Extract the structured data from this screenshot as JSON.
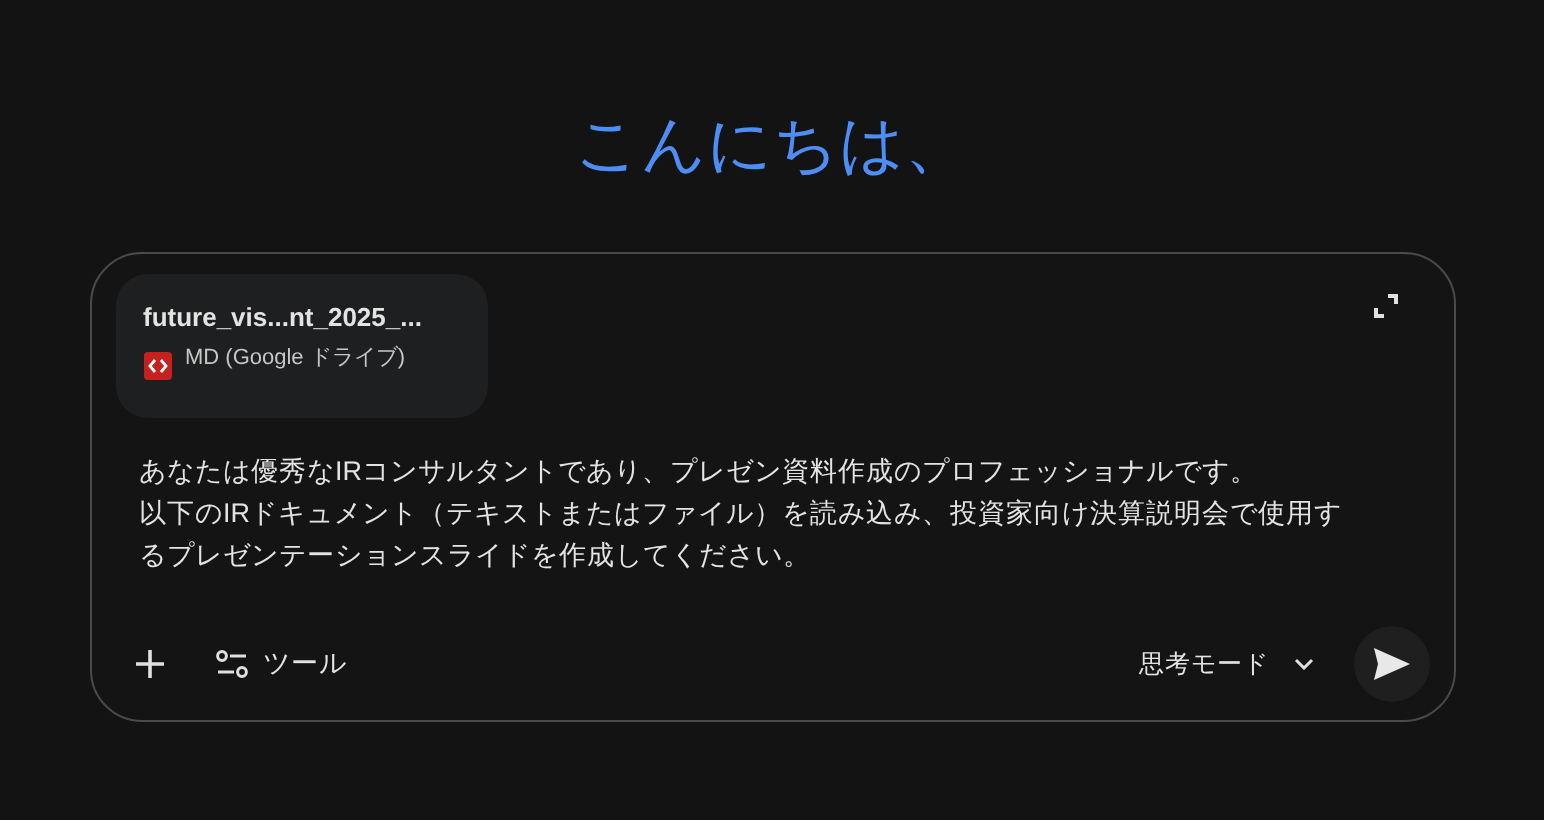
{
  "greeting": "こんにちは、",
  "attachment": {
    "name": "future_vis...nt_2025_...",
    "type": "MD (Google ドライブ)"
  },
  "prompt_lines": [
    "あなたは優秀なIRコンサルタントであり、プレゼン資料作成のプロフェッショナルです。",
    "以下のIRドキュメント（テキストまたはファイル）を読み込み、投資家向け決算説明会で使用す",
    "るプレゼンテーションスライドを作成してください。"
  ],
  "tools_button": "ツール",
  "mode": "思考モード"
}
